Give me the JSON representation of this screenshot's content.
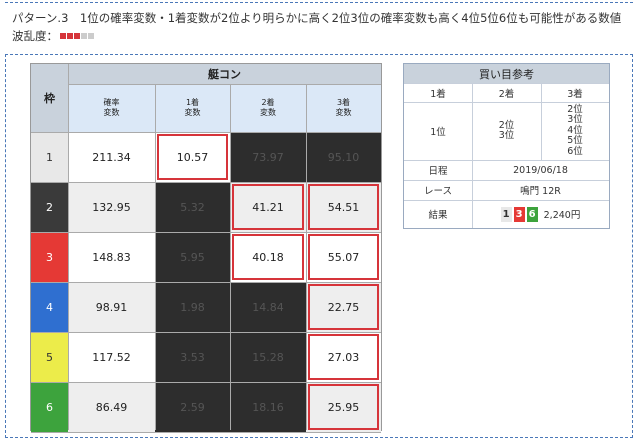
{
  "header": {
    "pattern_text": "パターン.3　1位の確率変数・1着変数が2位より明らかに高く2位3位の確率変数も高く4位5位6位も可能性がある数値",
    "volatility_label": "波乱度：",
    "volatility_level": 3,
    "volatility_max": 5,
    "pip_on_color": "#d6343a",
    "pip_off_color": "#cccccc"
  },
  "main_table": {
    "title": "艇コン",
    "corner": "枠",
    "columns": [
      {
        "line1": "確率",
        "line2": "変数"
      },
      {
        "line1": "1着",
        "line2": "変数"
      },
      {
        "line1": "2着",
        "line2": "変数"
      },
      {
        "line1": "3着",
        "line2": "変数"
      }
    ],
    "rows": [
      {
        "frame": "1",
        "frame_color": "#e8e8e8",
        "frame_text_color": "#333333",
        "cells": [
          {
            "v": "211.34",
            "s": "white",
            "red": false
          },
          {
            "v": "10.57",
            "s": "white",
            "red": true
          },
          {
            "v": "73.97",
            "s": "dark",
            "red": false
          },
          {
            "v": "95.10",
            "s": "dark",
            "red": false
          }
        ]
      },
      {
        "frame": "2",
        "frame_color": "#3a3a3a",
        "frame_text_color": "#ffffff",
        "cells": [
          {
            "v": "132.95",
            "s": "light",
            "red": false
          },
          {
            "v": "5.32",
            "s": "dark",
            "red": false
          },
          {
            "v": "41.21",
            "s": "light",
            "red": true
          },
          {
            "v": "54.51",
            "s": "light",
            "red": true
          }
        ]
      },
      {
        "frame": "3",
        "frame_color": "#e53935",
        "frame_text_color": "#ffffff",
        "cells": [
          {
            "v": "148.83",
            "s": "white",
            "red": false
          },
          {
            "v": "5.95",
            "s": "dark",
            "red": false
          },
          {
            "v": "40.18",
            "s": "white",
            "red": true
          },
          {
            "v": "55.07",
            "s": "white",
            "red": true
          }
        ]
      },
      {
        "frame": "4",
        "frame_color": "#2f6fd0",
        "frame_text_color": "#ffffff",
        "cells": [
          {
            "v": "98.91",
            "s": "light",
            "red": false
          },
          {
            "v": "1.98",
            "s": "dark",
            "red": false
          },
          {
            "v": "14.84",
            "s": "dark",
            "red": false
          },
          {
            "v": "22.75",
            "s": "light",
            "red": true
          }
        ]
      },
      {
        "frame": "5",
        "frame_color": "#ecec4a",
        "frame_text_color": "#333333",
        "cells": [
          {
            "v": "117.52",
            "s": "white",
            "red": false
          },
          {
            "v": "3.53",
            "s": "dark",
            "red": false
          },
          {
            "v": "15.28",
            "s": "dark",
            "red": false
          },
          {
            "v": "27.03",
            "s": "white",
            "red": true
          }
        ]
      },
      {
        "frame": "6",
        "frame_color": "#3da33d",
        "frame_text_color": "#ffffff",
        "cells": [
          {
            "v": "86.49",
            "s": "light",
            "red": false
          },
          {
            "v": "2.59",
            "s": "dark",
            "red": false
          },
          {
            "v": "18.16",
            "s": "dark",
            "red": false
          },
          {
            "v": "25.95",
            "s": "light",
            "red": true
          }
        ]
      }
    ]
  },
  "bet": {
    "title": "買い目参考",
    "col1": "1着",
    "col2": "2着",
    "col3": "3着",
    "first": "1位",
    "second": [
      "2位",
      "3位"
    ],
    "third": [
      "2位",
      "3位",
      "4位",
      "5位",
      "6位"
    ],
    "date_label": "日程",
    "date_value": "2019/06/18",
    "race_label": "レース",
    "race_value": "鳴門 12R",
    "result_label": "結果",
    "result_boats": [
      {
        "n": "1",
        "bg": "#e8e8e8",
        "fg": "#333333"
      },
      {
        "n": "3",
        "bg": "#e53935",
        "fg": "#ffffff"
      },
      {
        "n": "6",
        "bg": "#3da33d",
        "fg": "#ffffff"
      }
    ],
    "payout": "2,240円"
  }
}
